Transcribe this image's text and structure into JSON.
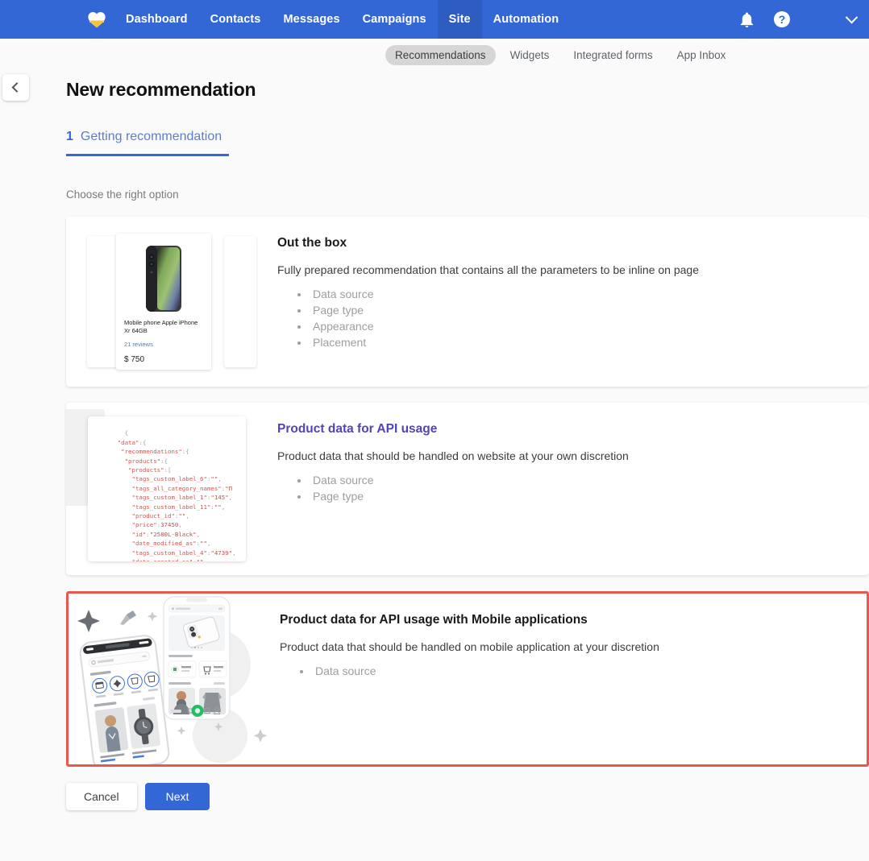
{
  "topnav": {
    "logo": "heart-logo-icon",
    "links": [
      {
        "label": "Dashboard",
        "active": false
      },
      {
        "label": "Contacts",
        "active": false
      },
      {
        "label": "Messages",
        "active": false
      },
      {
        "label": "Campaigns",
        "active": false
      },
      {
        "label": "Site",
        "active": true
      },
      {
        "label": "Automation",
        "active": false
      }
    ],
    "bell_icon": "notification-bell-icon",
    "help_icon": "help-question-icon",
    "help_glyph": "?",
    "account_chevron": "chevron-down-icon",
    "bg_color": "#3367d6",
    "active_bg_color": "#2e5dc0"
  },
  "subnav": {
    "tabs": [
      {
        "label": "Recommendations",
        "active": true
      },
      {
        "label": "Widgets",
        "active": false
      },
      {
        "label": "Integrated forms",
        "active": false
      },
      {
        "label": "App Inbox",
        "active": false
      }
    ]
  },
  "back_button": {
    "icon": "chevron-left-icon"
  },
  "page": {
    "title": "New recommendation",
    "step": {
      "number": "1",
      "label": "Getting recommendation",
      "accent_color": "#3367d6"
    },
    "hint": "Choose the right option"
  },
  "options": [
    {
      "title": "Out the box",
      "title_color": "#1a1a1a",
      "description": "Fully prepared recommendation that contains all the parameters to be inline on page",
      "features": [
        "Data source",
        "Page type",
        "Appearance",
        "Placement"
      ],
      "selected": false,
      "media": "product-card-carousel",
      "product": {
        "name": "Mobile phone Apple iPhone Xr 64GB",
        "reviews": "21 reviews",
        "price": "$ 750"
      }
    },
    {
      "title": "Product data for API usage",
      "title_color": "#5145b5",
      "description": "Product data that should be handled on website at your own discretion",
      "features": [
        "Data source",
        "Page type"
      ],
      "selected": false,
      "media": "json-code-preview",
      "code": "        {\n      \"data\":{\n       \"recommendations\":{\n        \"products\":{\n         \"products\":[\n          \"tags_custom_label_6\":\"\",\n          \"tags_all_category_names\":\"П\n          \"tags_custom_label_1\":\"145\",\n          \"tags_custom_label_11\":\"\",\n          \"product_id\":\"\",\n          \"price\":37450,\n          \"id\":\"2580L-Black\",\n          \"date_modified_as\":\"\",\n          \"tags_custom_label_4\":\"4739\",\n          \"date_created_es\":\"\",\n          \"tags_is_bestseller\":\"false\""
    },
    {
      "title": "Product data for API usage with Mobile applications",
      "title_color": "#1a1a1a",
      "description": "Product data that should be handled on mobile application at your discretion",
      "features": [
        "Data source"
      ],
      "selected": true,
      "highlight_color": "#e8584f",
      "media": "mobile-app-mockup"
    }
  ],
  "footer": {
    "cancel_label": "Cancel",
    "next_label": "Next",
    "next_color": "#3367d6"
  }
}
